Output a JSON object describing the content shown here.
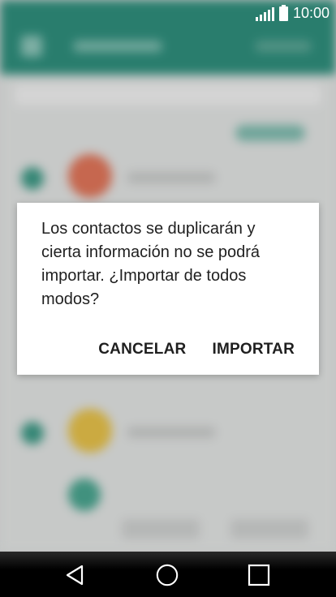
{
  "status_bar": {
    "time": "10:00",
    "signal_icon": "signal-bars-icon",
    "battery_icon": "battery-icon"
  },
  "dialog": {
    "message": "Los contactos se duplicarán y cierta información no se podrá importar. ¿Importar de todos modos?",
    "cancel_label": "CANCELAR",
    "confirm_label": "IMPORTAR"
  },
  "nav_bar": {
    "back_icon": "back-triangle-icon",
    "home_icon": "home-circle-icon",
    "recents_icon": "recents-square-icon"
  },
  "colors": {
    "app_bar": "#2f8f7d",
    "dialog_bg": "#ffffff",
    "nav_bar": "#000000"
  }
}
